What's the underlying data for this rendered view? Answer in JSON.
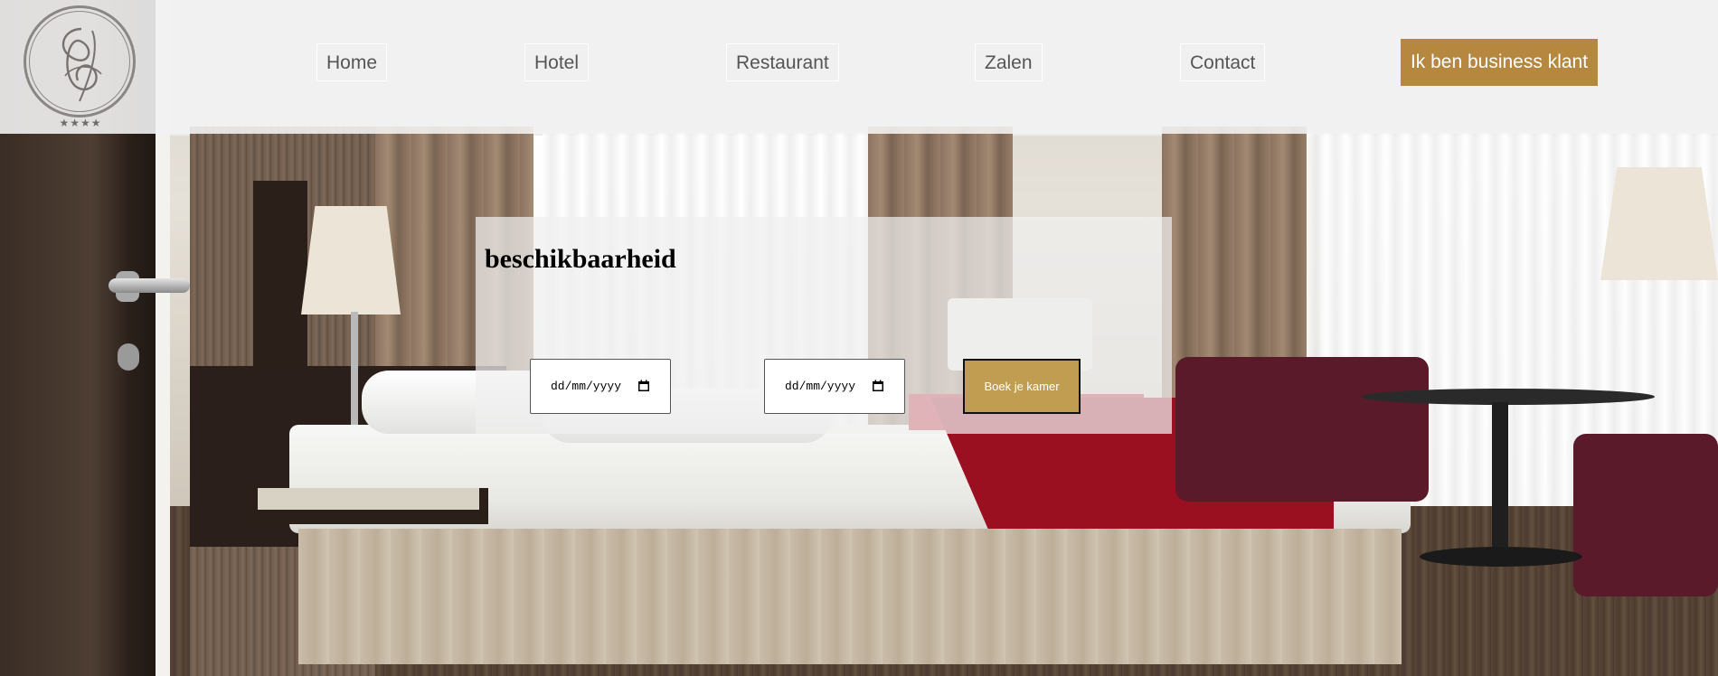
{
  "brand": {
    "logo_stars": "★★★★",
    "accent_color": "#b5873f",
    "button_color": "#c19d52"
  },
  "nav": {
    "items": [
      {
        "label": "Home"
      },
      {
        "label": "Hotel"
      },
      {
        "label": "Restaurant"
      },
      {
        "label": "Zalen"
      },
      {
        "label": "Contact"
      }
    ],
    "business_button": "Ik ben business klant"
  },
  "availability": {
    "title": "beschikbaarheid",
    "checkin_placeholder": "dd/mm/yyyy",
    "checkout_placeholder": "dd/mm/yyyy",
    "book_button": "Boek je kamer"
  },
  "icons": {
    "logo": "monogram-logo-icon",
    "date_picker": "calendar-icon"
  }
}
